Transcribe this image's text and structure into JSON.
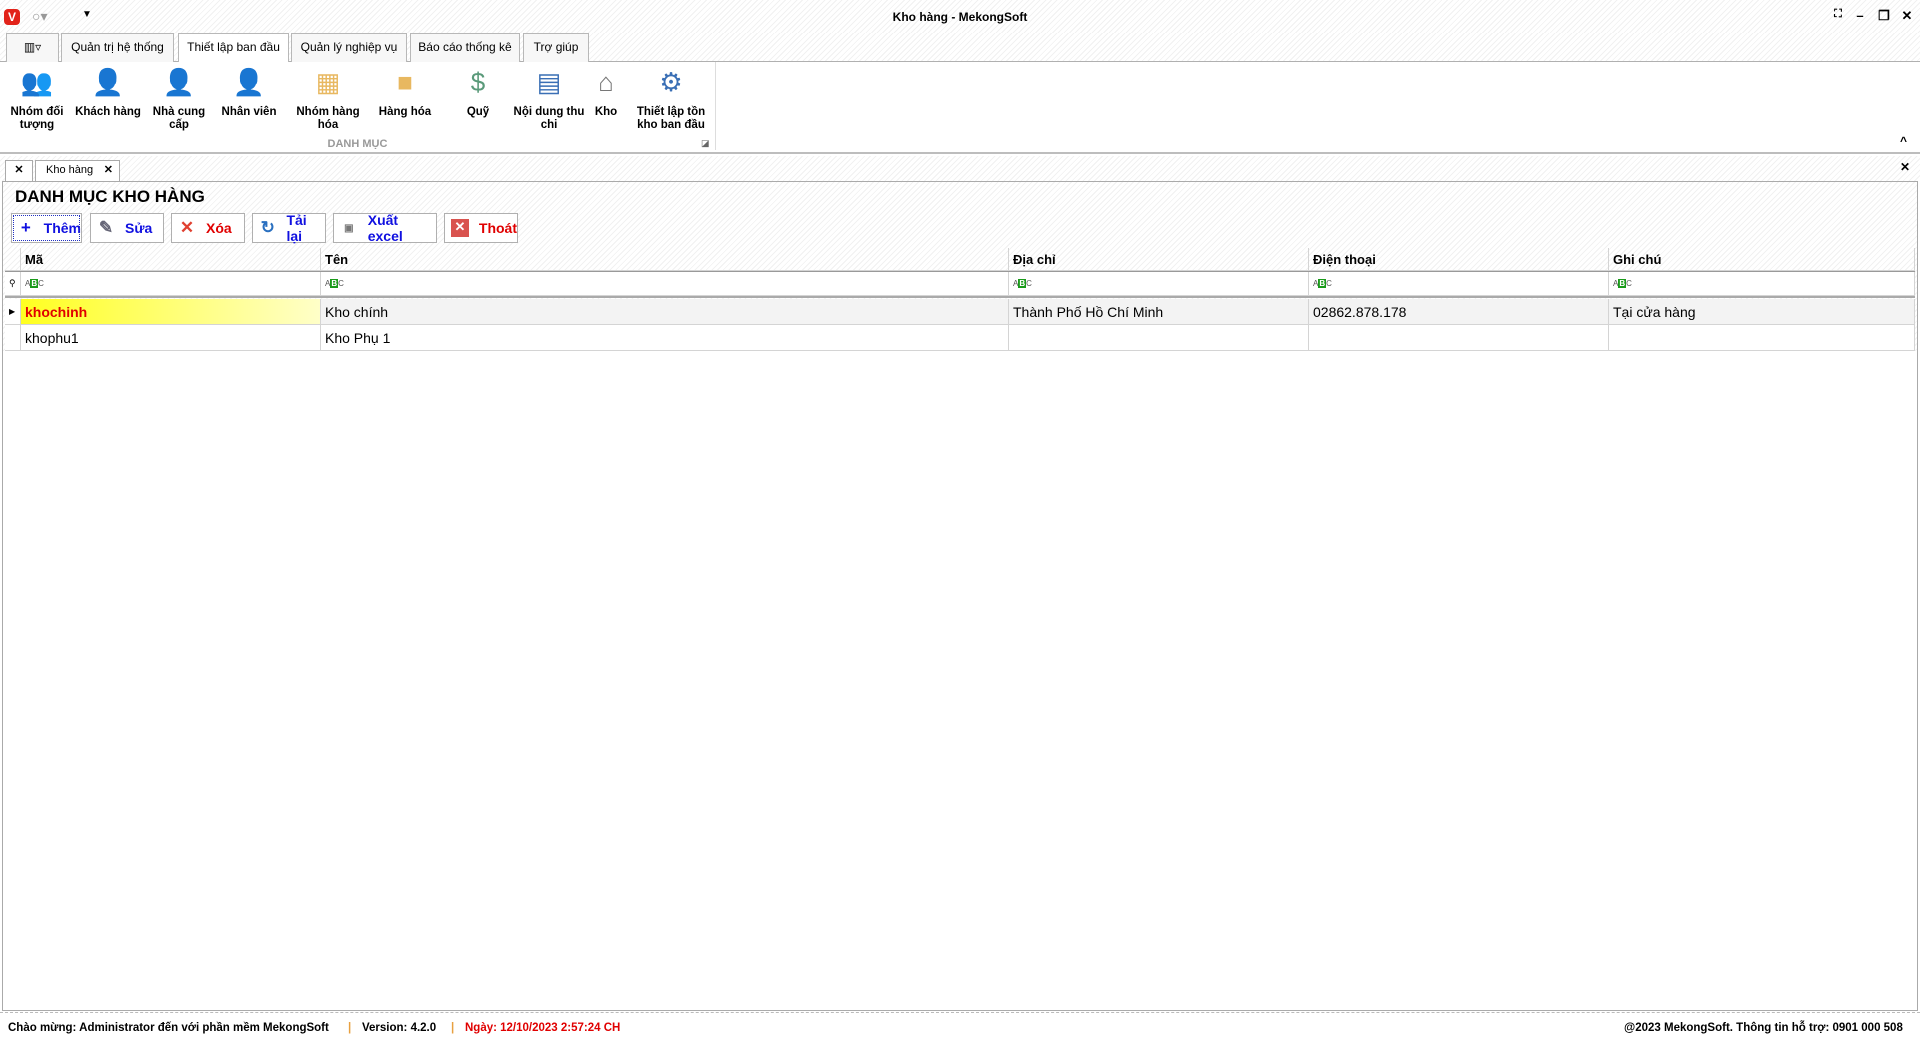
{
  "window": {
    "title": "Kho hàng - MekongSoft",
    "logo": "V"
  },
  "ribbon_tabs": [
    {
      "label": "Quản trị hệ thống"
    },
    {
      "label": "Thiết lập ban đầu",
      "active": true
    },
    {
      "label": "Quản lý nghiệp vụ"
    },
    {
      "label": "Báo cáo thống kê"
    },
    {
      "label": "Trợ giúp"
    }
  ],
  "ribbon": {
    "group_label": "DANH MỤC",
    "buttons": [
      {
        "label": "Nhóm đối tượng",
        "icon": "user-group-icon"
      },
      {
        "label": "Khách hàng",
        "icon": "customer-icon"
      },
      {
        "label": "Nhà cung cấp",
        "icon": "supplier-icon"
      },
      {
        "label": "Nhân viên",
        "icon": "employee-icon"
      },
      {
        "label": "Nhóm hàng hóa",
        "icon": "box-group-icon"
      },
      {
        "label": "Hàng hóa",
        "icon": "box-icon"
      },
      {
        "label": "Quỹ",
        "icon": "money-icon"
      },
      {
        "label": "Nội dung thu chi",
        "icon": "document-add-icon"
      },
      {
        "label": "Kho",
        "icon": "house-icon"
      },
      {
        "label": "Thiết lập tồn kho ban đầu",
        "icon": "gears-icon"
      }
    ]
  },
  "doc_tab": {
    "label": "Kho hàng"
  },
  "panel": {
    "title": "DANH MỤC KHO HÀNG"
  },
  "toolbar": [
    {
      "label": "Thêm",
      "icon": "plus-icon",
      "color": "#1010e0"
    },
    {
      "label": "Sửa",
      "icon": "edit-icon",
      "color": "#1010e0"
    },
    {
      "label": "Xóa",
      "icon": "delete-icon",
      "color": "#e00000"
    },
    {
      "label": "Tải lại",
      "icon": "refresh-icon",
      "color": "#1010e0"
    },
    {
      "label": "Xuất excel",
      "icon": "excel-icon",
      "color": "#1010e0"
    },
    {
      "label": "Thoát",
      "icon": "exit-icon",
      "color": "#e00000"
    }
  ],
  "grid": {
    "columns": [
      "Mã",
      "Tên",
      "Địa chỉ",
      "Điện thoại",
      "Ghi chú"
    ],
    "rows": [
      [
        "khochinh",
        "Kho chính",
        "Thành Phố Hồ Chí Minh",
        "02862.878.178",
        "Tại cửa hàng"
      ],
      [
        "khophu1",
        "Kho Phụ 1",
        "",
        "",
        ""
      ]
    ],
    "selected_row": 0
  },
  "status": {
    "welcome": "Chào mừng: Administrator đến với phần mềm MekongSoft",
    "version": "Version: 4.2.0",
    "date": "Ngày: 12/10/2023 2:57:24 CH",
    "copyright": "@2023 MekongSoft. Thông tin hỗ trợ: 0901 000 508"
  }
}
